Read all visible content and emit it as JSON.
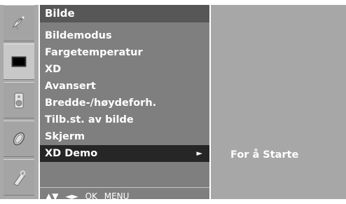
{
  "menu": {
    "title": "Bilde",
    "items": [
      {
        "label": "Bildemodus"
      },
      {
        "label": "Fargetemperatur"
      },
      {
        "label": "XD"
      },
      {
        "label": "Avansert"
      },
      {
        "label": "Bredde-/høydeforh."
      },
      {
        "label": "Tilb.st. av bilde"
      },
      {
        "label": "Skjerm"
      },
      {
        "label": "XD Demo",
        "selected": true,
        "arrow": "►"
      }
    ],
    "nav": {
      "updown": "▲▼",
      "leftright": "◄►",
      "ok": "OK",
      "menu": "MENU"
    }
  },
  "submenu": {
    "item": "For å Starte"
  },
  "icons": [
    {
      "name": "satellite-dish-icon"
    },
    {
      "name": "picture-icon",
      "active": true
    },
    {
      "name": "speaker-icon"
    },
    {
      "name": "clock-icon"
    },
    {
      "name": "usb-key-icon"
    }
  ],
  "colors": {
    "title_bar": "#575757",
    "menu_bg": "#7f7f7f",
    "selected_bg": "#262626",
    "submenu_bg": "#a7a7a7"
  }
}
